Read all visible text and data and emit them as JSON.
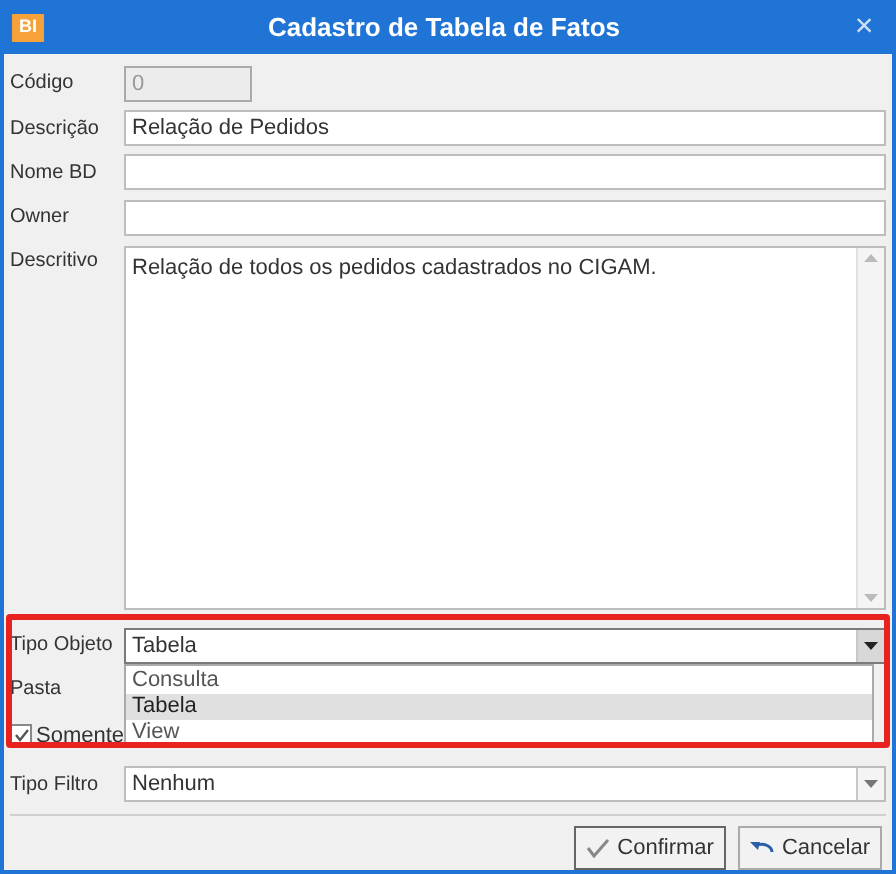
{
  "window": {
    "app_badge": "BI",
    "title": "Cadastro de Tabela de Fatos",
    "close": "×"
  },
  "fields": [
    {
      "label": "Código",
      "value": "0",
      "disabled": true,
      "kind": "short"
    },
    {
      "label": "Descrição",
      "value": "Relação de Pedidos",
      "disabled": false,
      "kind": "text"
    },
    {
      "label": "Nome BD",
      "disabled": false,
      "kind": "text"
    },
    {
      "label": "Owner",
      "disabled": false,
      "kind": "text"
    }
  ],
  "descritivo": {
    "label": "Descritivo",
    "value": "Relação de todos os pedidos cadastrados no CIGAM."
  },
  "tipo_objeto": {
    "label": "Tipo Objeto",
    "value": "Tabela",
    "expanded": true,
    "options": [
      {
        "label": "Consulta",
        "selected": false
      },
      {
        "label": "Tabela",
        "selected": true
      },
      {
        "label": "View",
        "selected": false
      }
    ]
  },
  "pasta": {
    "label": "Pasta"
  },
  "somente": {
    "label": "Somente",
    "checked": true
  },
  "tipo_filtro": {
    "label": "Tipo Filtro",
    "value": "Nenhum"
  },
  "buttons": [
    {
      "label": "Confirmar",
      "kind": "confirm"
    },
    {
      "label": "Cancelar",
      "kind": "cancel"
    }
  ]
}
